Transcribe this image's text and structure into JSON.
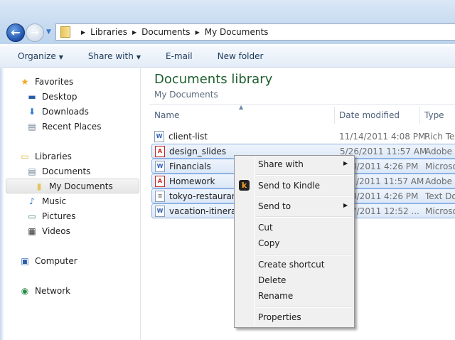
{
  "nav": {
    "back_icon": "back-arrow",
    "forward_icon": "forward-arrow"
  },
  "address": {
    "crumbs": [
      "Libraries",
      "Documents",
      "My Documents"
    ]
  },
  "toolbar": {
    "organize": "Organize",
    "share_with": "Share with",
    "email": "E-mail",
    "new_folder": "New folder"
  },
  "sidebar": {
    "items": [
      {
        "label": "Favorites",
        "icon": "star-icon"
      },
      {
        "label": "Desktop",
        "icon": "desktop-icon"
      },
      {
        "label": "Downloads",
        "icon": "downloads-icon"
      },
      {
        "label": "Recent Places",
        "icon": "recent-places-icon"
      },
      {
        "label": "Libraries",
        "icon": "libraries-icon"
      },
      {
        "label": "Documents",
        "icon": "documents-icon"
      },
      {
        "label": "My Documents",
        "icon": "folder-icon",
        "selected": true
      },
      {
        "label": "Music",
        "icon": "music-icon"
      },
      {
        "label": "Pictures",
        "icon": "pictures-icon"
      },
      {
        "label": "Videos",
        "icon": "videos-icon"
      },
      {
        "label": "Computer",
        "icon": "computer-icon"
      },
      {
        "label": "Network",
        "icon": "network-icon"
      }
    ]
  },
  "library": {
    "title": "Documents library",
    "subtitle": "My Documents"
  },
  "columns": {
    "name": "Name",
    "date": "Date modified",
    "type": "Type"
  },
  "files": [
    {
      "name": "client-list",
      "date": "11/14/2011 4:08 PM",
      "type": "Rich Tex",
      "kind": "word",
      "selected": false
    },
    {
      "name": "design_slides",
      "date": "5/26/2011 11:57 AM",
      "type": "Adobe A",
      "kind": "pdf",
      "selected": true
    },
    {
      "name": "Financials",
      "date": "8/2011 4:26 PM",
      "type": "Microso",
      "kind": "word",
      "selected": true
    },
    {
      "name": "Homework",
      "date": "/2011 11:57 AM",
      "type": "Adobe A",
      "kind": "pdf",
      "selected": true
    },
    {
      "name": "tokyo-restaurants",
      "date": "8/2011 4:26 PM",
      "type": "Text Doc",
      "kind": "txt",
      "selected": true
    },
    {
      "name": "vacation-itinerary",
      "date": "7/2011 12:52 ...",
      "type": "Microso",
      "kind": "word",
      "selected": true
    }
  ],
  "context_menu": {
    "share_with": "Share with",
    "send_to_kindle": "Send to Kindle",
    "send_to": "Send to",
    "cut": "Cut",
    "copy": "Copy",
    "create_shortcut": "Create shortcut",
    "delete": "Delete",
    "rename": "Rename",
    "properties": "Properties"
  }
}
